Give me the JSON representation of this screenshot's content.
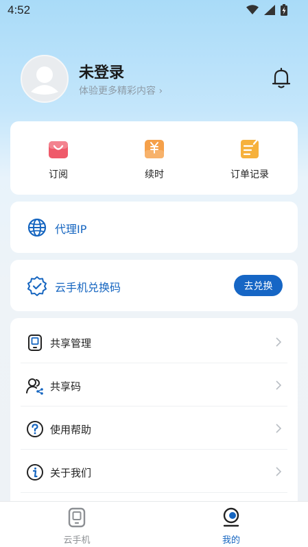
{
  "status_bar": {
    "time": "4:52"
  },
  "profile": {
    "name": "未登录",
    "subtitle": "体验更多精彩内容 ›"
  },
  "quick_actions": [
    {
      "label": "订阅",
      "icon": "shopping-bag-icon",
      "color": "#ef5a6a"
    },
    {
      "label": "续时",
      "icon": "yen-box-icon",
      "color": "#f5a04a"
    },
    {
      "label": "订单记录",
      "icon": "order-note-icon",
      "color": "#f6b13c"
    }
  ],
  "proxy": {
    "label": "代理IP",
    "icon": "globe-icon"
  },
  "redeem": {
    "label": "云手机兑换码",
    "button": "去兑换",
    "icon": "verified-badge-icon"
  },
  "menu": [
    {
      "label": "共享管理",
      "icon": "device-share-icon"
    },
    {
      "label": "共享码",
      "icon": "users-share-icon"
    },
    {
      "label": "使用帮助",
      "icon": "help-icon"
    },
    {
      "label": "关于我们",
      "icon": "info-icon"
    }
  ],
  "tabs": [
    {
      "label": "云手机",
      "icon": "cloud-phone-icon",
      "active": false
    },
    {
      "label": "我的",
      "icon": "profile-tab-icon",
      "active": true
    }
  ],
  "colors": {
    "accent": "#1666c5",
    "text_blue": "#1565c0",
    "tab_inactive": "#8c8f93"
  }
}
